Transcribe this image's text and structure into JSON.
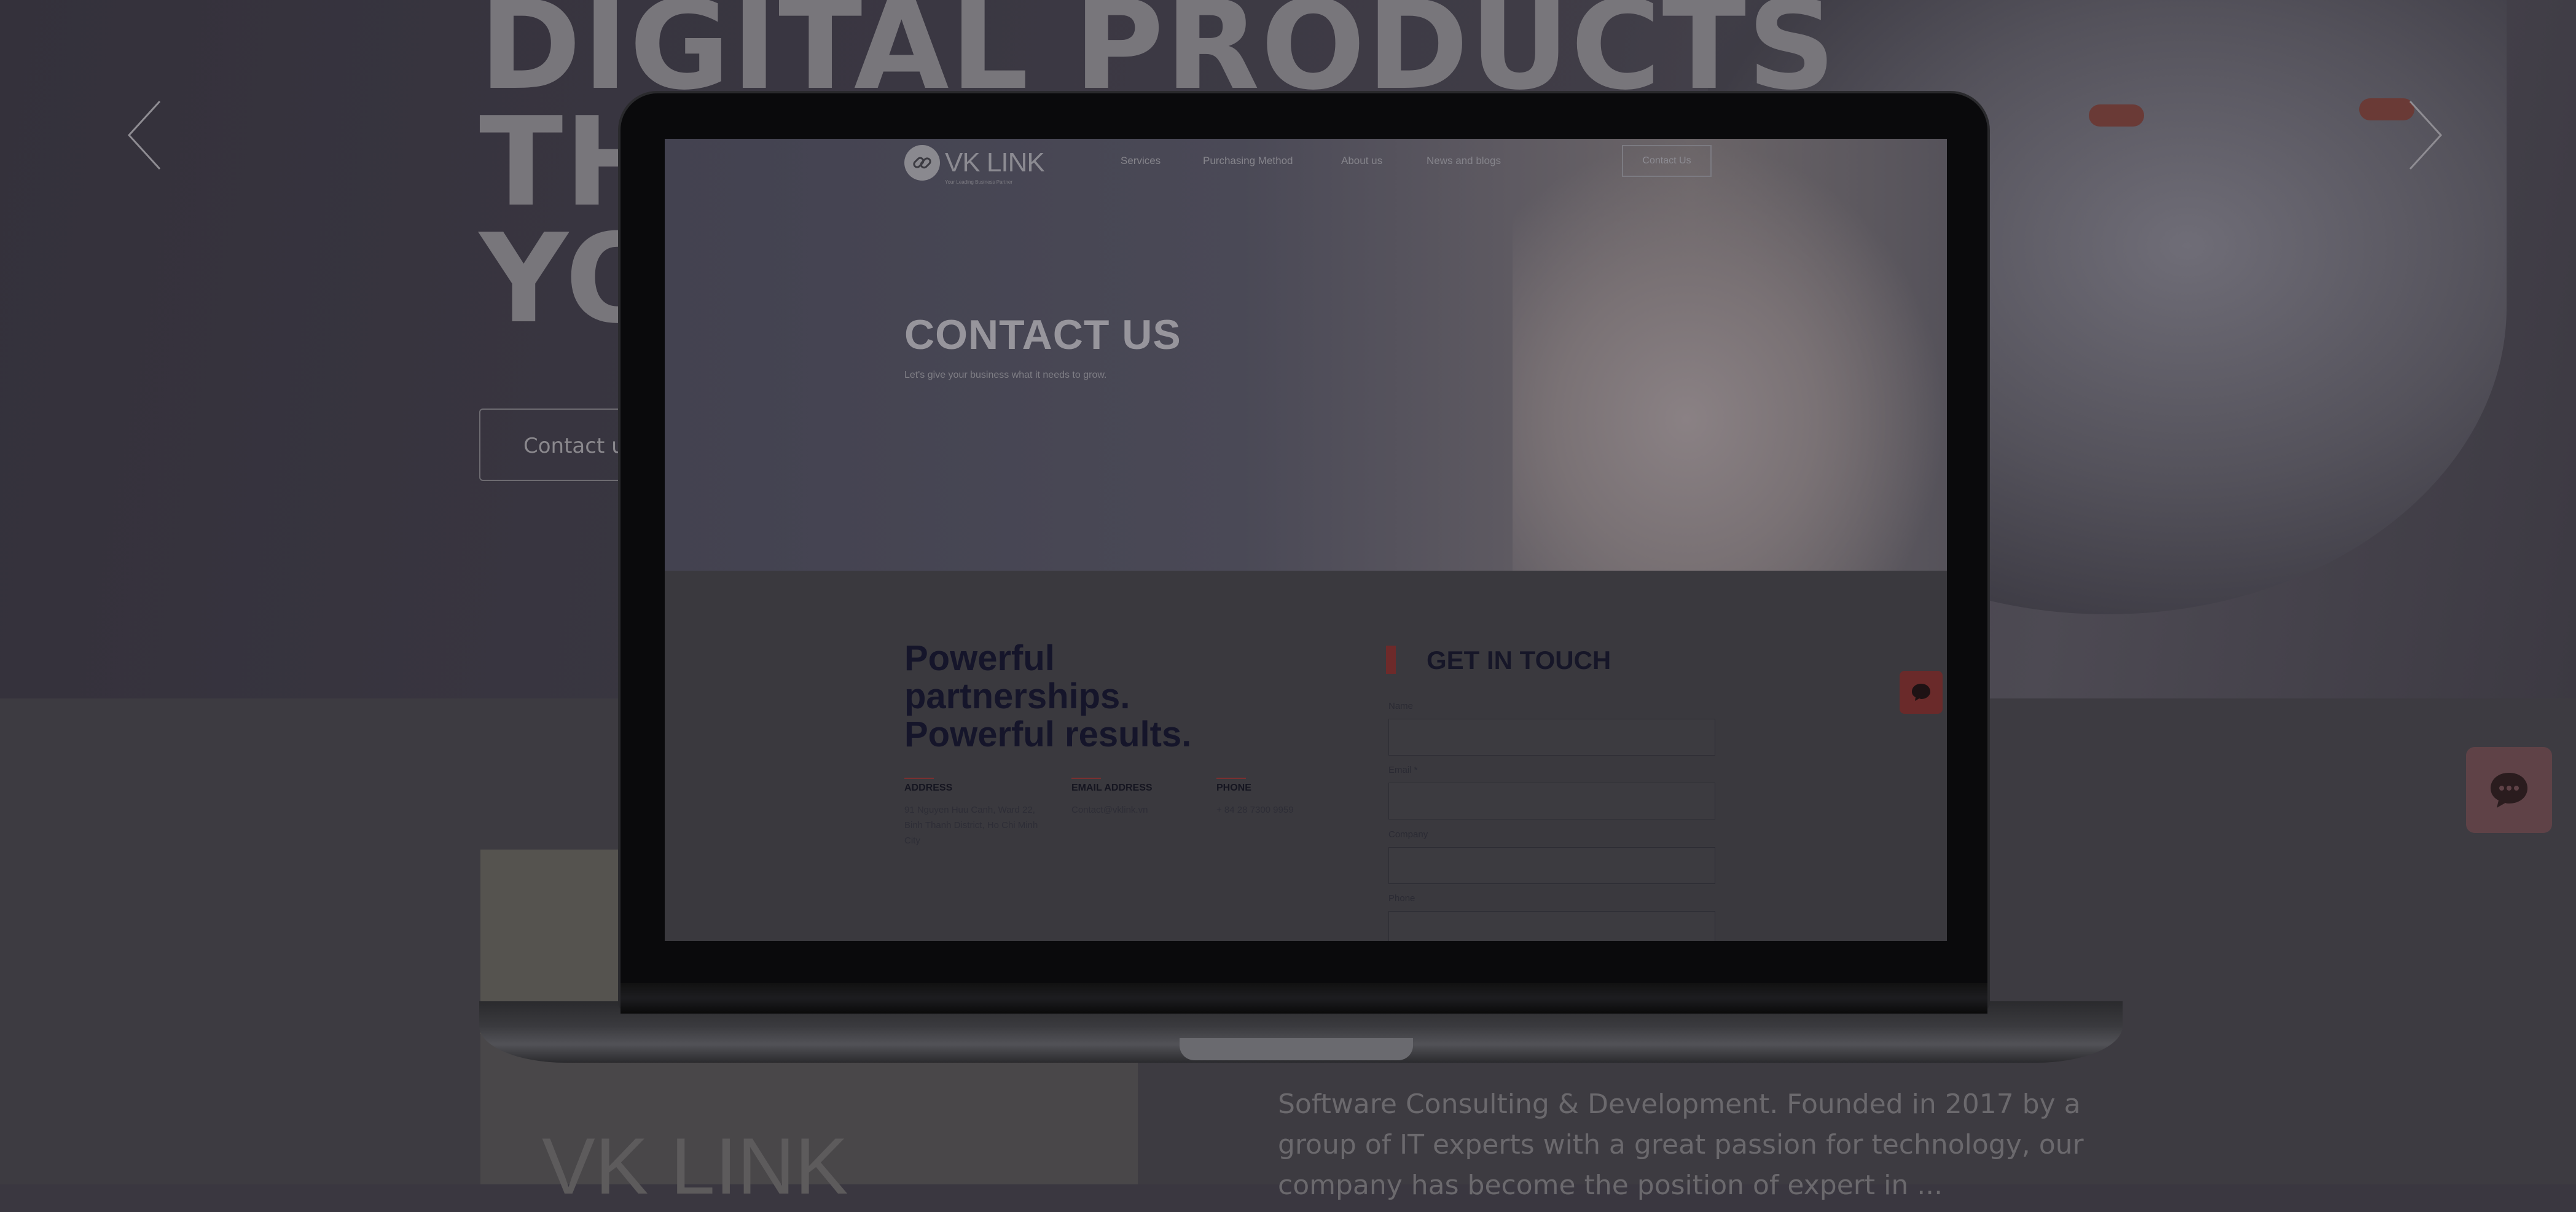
{
  "hero": {
    "title_lines": [
      "DIGITAL PRODUCTS",
      "TH",
      "YO"
    ],
    "title": "DIGITAL PRODUCTS\nTH\nYO",
    "cta_label": "Contact us",
    "prev_icon": "chevron-left-icon",
    "next_icon": "chevron-right-icon"
  },
  "chat_widget": {
    "icon": "chat-bubble-icon",
    "color": "#5f4247"
  },
  "about": {
    "lines": [
      "Software Consulting & Development. Founded in 2017 by a",
      "group of IT experts with a great passion for technology, our",
      "company has become the position of expert in ..."
    ]
  },
  "screen": {
    "logo": {
      "text": "VK LINK",
      "tagline": "Your Leading Business Partner",
      "icon": "link-icon"
    },
    "nav": [
      "Services",
      "Purchasing Method",
      "About us",
      "News and blogs"
    ],
    "nav_button": "Contact Us",
    "hero_title": "CONTACT US",
    "hero_subtitle": "Let's give your business what it needs to grow.",
    "tagline_lines": [
      "Powerful",
      "partnerships.",
      "Powerful results."
    ],
    "contacts": [
      {
        "label": "ADDRESS",
        "value": "91 Nguyen Huu Canh, Ward 22, Binh Thanh District, Ho Chi Minh City"
      },
      {
        "label": "EMAIL ADDRESS",
        "value": "Contact@vklink.vn"
      },
      {
        "label": "PHONE",
        "value": "+ 84 28 7300 9959"
      }
    ],
    "form": {
      "title": "GET IN TOUCH",
      "fields": [
        "Name",
        "Email *",
        "Company",
        "Phone"
      ]
    },
    "chat_icon": "chat-bubble-icon",
    "accent_color": "#6d2a2a"
  }
}
